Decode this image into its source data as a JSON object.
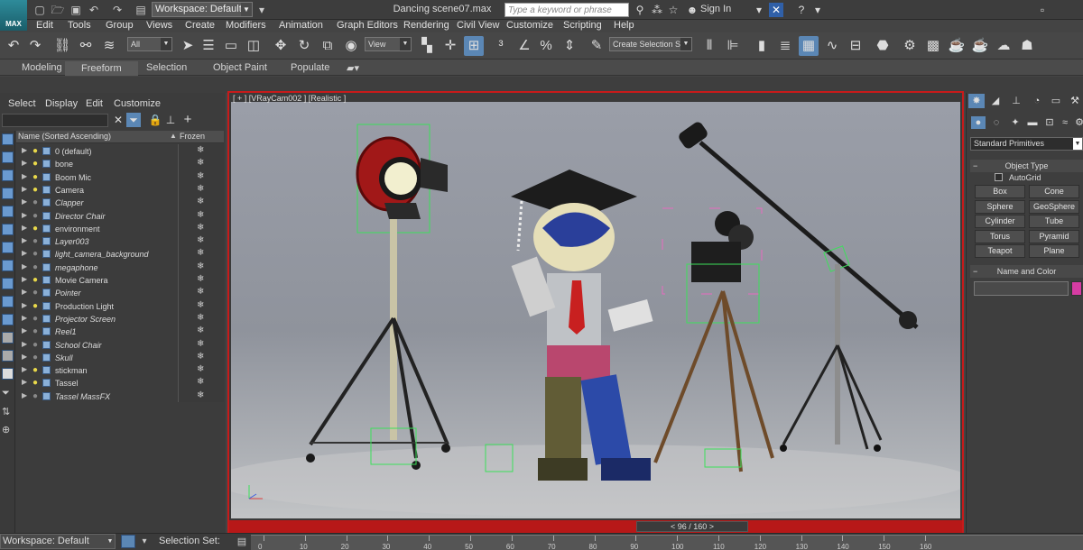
{
  "title_bar": {
    "app_logo_text": "MAX",
    "workspace_dropdown": "Workspace: Default",
    "document_title": "Dancing scene07.max",
    "search_placeholder": "Type a keyword or phrase",
    "sign_in": "Sign In"
  },
  "menu": [
    "Edit",
    "Tools",
    "Group",
    "Views",
    "Create",
    "Modifiers",
    "Animation",
    "Graph Editors",
    "Rendering",
    "Civil View",
    "Customize",
    "Scripting",
    "Help"
  ],
  "toolbar": {
    "selection_filter": "All",
    "ref_coord": "View",
    "selection_set": "Create Selection Se"
  },
  "ribbon": {
    "tabs": [
      "Modeling",
      "Freeform",
      "Selection",
      "Object Paint",
      "Populate"
    ],
    "active_tab": "Freeform"
  },
  "scene_explorer": {
    "menu": [
      "Select",
      "Display",
      "Edit",
      "Customize"
    ],
    "column_name": "Name (Sorted Ascending)",
    "column_frozen": "Frozen",
    "layers": [
      {
        "name": "0 (default)",
        "italic": false,
        "bulb": true
      },
      {
        "name": "bone",
        "italic": false,
        "bulb": true
      },
      {
        "name": "Boom Mic",
        "italic": false,
        "bulb": true
      },
      {
        "name": "Camera",
        "italic": false,
        "bulb": true
      },
      {
        "name": "Clapper",
        "italic": true,
        "bulb": false
      },
      {
        "name": "Director Chair",
        "italic": true,
        "bulb": false
      },
      {
        "name": "environment",
        "italic": false,
        "bulb": true
      },
      {
        "name": "Layer003",
        "italic": true,
        "bulb": false
      },
      {
        "name": "light_camera_background",
        "italic": true,
        "bulb": false
      },
      {
        "name": "megaphone",
        "italic": true,
        "bulb": false
      },
      {
        "name": "Movie Camera",
        "italic": false,
        "bulb": true
      },
      {
        "name": "Pointer",
        "italic": true,
        "bulb": false
      },
      {
        "name": "Production Light",
        "italic": false,
        "bulb": true
      },
      {
        "name": "Projector Screen",
        "italic": true,
        "bulb": false
      },
      {
        "name": "Reel1",
        "italic": true,
        "bulb": false
      },
      {
        "name": "School Chair",
        "italic": true,
        "bulb": false
      },
      {
        "name": "Skull",
        "italic": true,
        "bulb": false
      },
      {
        "name": "stickman",
        "italic": false,
        "bulb": true
      },
      {
        "name": "Tassel",
        "italic": false,
        "bulb": true
      },
      {
        "name": "Tassel MassFX",
        "italic": true,
        "bulb": false
      }
    ]
  },
  "viewport": {
    "label": "[ + ] [VRayCam002 ] [Realistic ]",
    "frame_counter": "96 / 160"
  },
  "command_panel": {
    "category_dropdown": "Standard Primitives",
    "object_type_header": "Object Type",
    "autogrid_label": "AutoGrid",
    "primitives": [
      "Box",
      "Cone",
      "Sphere",
      "GeoSphere",
      "Cylinder",
      "Tube",
      "Torus",
      "Pyramid",
      "Teapot",
      "Plane"
    ],
    "name_color_header": "Name and Color",
    "swatch_color": "#d63ca3"
  },
  "status_bar": {
    "workspace": "Workspace: Default",
    "selection_set": "Selection Set:"
  },
  "timeline": {
    "ticks": [
      "0",
      "10",
      "20",
      "30",
      "40",
      "50",
      "60",
      "70",
      "80",
      "90",
      "100",
      "110",
      "120",
      "130",
      "140",
      "150",
      "160"
    ]
  },
  "colors": {
    "viewport_border": "#c71a1a",
    "active_blue": "#5b87b5",
    "helper_green": "#3ce05a",
    "helper_pink": "#e86ac0"
  }
}
